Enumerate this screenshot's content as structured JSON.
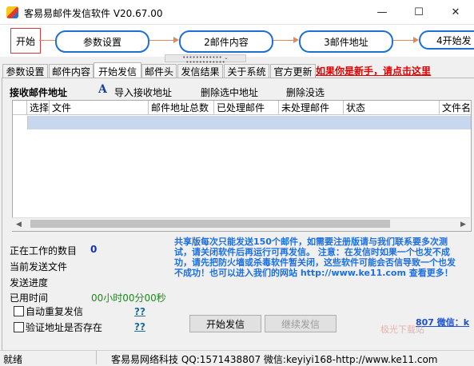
{
  "window": {
    "title": "客易易邮件发信软件 V20.67.00",
    "minimize_glyph": "—",
    "maximize_glyph": "☐",
    "close_glyph": "✕"
  },
  "flow": {
    "start": "开始",
    "steps": [
      "参数设置",
      "2邮件内容",
      "3邮件地址",
      "4开始发"
    ]
  },
  "splitter_glyph": "••••••••••••  ⌄  ••••••••••••",
  "tabs": [
    "参数设置",
    "邮件内容",
    "开始发信",
    "邮件头",
    "发信结果",
    "关于系统",
    "官方更新"
  ],
  "active_tab": "开始发信",
  "newbie_link": "如果你是新手，请点击这里",
  "toolbar": {
    "section_label": "接收邮件地址",
    "import_icon": "A",
    "import_label": "导入接收地址",
    "delete_selected_label": "删除选中地址",
    "delete_none_label": "删除没选"
  },
  "grid": {
    "columns": [
      "选择",
      "文件",
      "邮件地址总数",
      "已处理邮件",
      "未处理邮件",
      "状态",
      "文件名"
    ]
  },
  "status_panel": {
    "working_count_label": "正在工作的数目",
    "working_count_value": "0",
    "current_file_label": "当前发送文件",
    "progress_label": "发送进度",
    "elapsed_label": "已用时间",
    "elapsed_value": "00小时00分00秒",
    "auto_resend_label": "自动重复发信",
    "verify_label": "验证地址是否存在",
    "help_link": "??"
  },
  "notice_text": "共享版每次只能发送150个邮件，如需要注册版请与我们联系要多次测试，请关闭软件后再运行可再发信。 注意：在发信时如果一个也发不成功，请先把防火墙或杀毒软件暂关闭，这些软件可能会否信导致一个也发不成功！也可以进入我们的网站 http://www.ke11.com 查看更多！",
  "buttons": {
    "start_send": "开始发信",
    "continue_send": "继续发信"
  },
  "wechat_link": "807  微信：k",
  "watermark": "极光下载站",
  "statusbar": {
    "ready": "就绪",
    "info": "客易易网络科技 QQ:1571438807 微信:keyiyi168-http://www.ke11.com"
  },
  "colors": {
    "accent_blue": "#1e6fd2",
    "link_red": "#e00000",
    "notice_blue": "#1d6fe0",
    "selected_row": "#c7d7ee"
  }
}
